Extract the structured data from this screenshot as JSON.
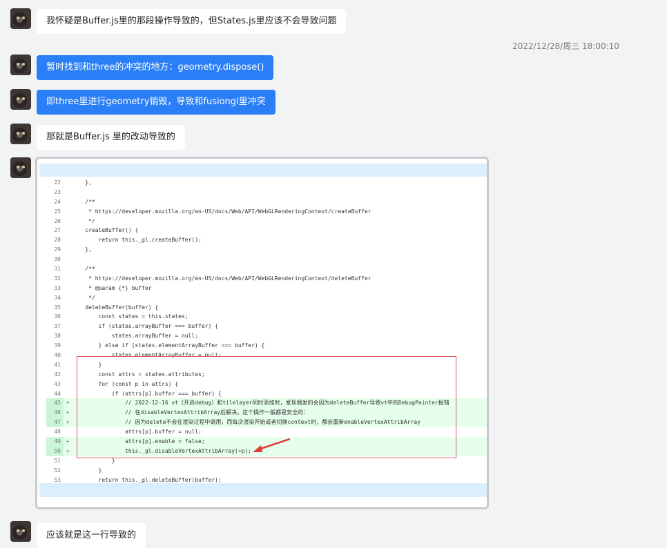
{
  "messages": [
    {
      "text": "我怀疑是Buffer.js里的那段操作导致的，但States.js里应该不会导致问题"
    },
    {
      "text": "暂时找到和three的冲突的地方：geometry.dispose()"
    },
    {
      "text": "即three里进行geometry销毁，导致和fusiongl里冲突"
    },
    {
      "text": "那就是Buffer.js 里的改动导致的"
    },
    {
      "text": "应该就是这一行导致的"
    }
  ],
  "timestamp": "2022/12/28/周三 18:00:10",
  "code": {
    "lines": [
      {
        "n": "22",
        "m": "",
        "t": "    },"
      },
      {
        "n": "23",
        "m": "",
        "t": ""
      },
      {
        "n": "24",
        "m": "",
        "t": "    /**"
      },
      {
        "n": "25",
        "m": "",
        "t": "     * https://developer.mozilla.org/en-US/docs/Web/API/WebGLRenderingContext/createBuffer"
      },
      {
        "n": "26",
        "m": "",
        "t": "     */"
      },
      {
        "n": "27",
        "m": "",
        "t": "    createBuffer() {"
      },
      {
        "n": "28",
        "m": "",
        "t": "        return this._gl.createBuffer();"
      },
      {
        "n": "29",
        "m": "",
        "t": "    },"
      },
      {
        "n": "30",
        "m": "",
        "t": ""
      },
      {
        "n": "31",
        "m": "",
        "t": "    /**"
      },
      {
        "n": "32",
        "m": "",
        "t": "     * https://developer.mozilla.org/en-US/docs/Web/API/WebGLRenderingContext/deleteBuffer"
      },
      {
        "n": "33",
        "m": "",
        "t": "     * @param {*} buffer"
      },
      {
        "n": "34",
        "m": "",
        "t": "     */"
      },
      {
        "n": "35",
        "m": "",
        "t": "    deleteBuffer(buffer) {"
      },
      {
        "n": "36",
        "m": "",
        "t": "        const states = this.states;"
      },
      {
        "n": "37",
        "m": "",
        "t": "        if (states.arrayBuffer === buffer) {"
      },
      {
        "n": "38",
        "m": "",
        "t": "            states.arrayBuffer = null;"
      },
      {
        "n": "39",
        "m": "",
        "t": "        } else if (states.elementArrayBuffer === buffer) {"
      },
      {
        "n": "40",
        "m": "",
        "t": "            states.elementArrayBuffer = null;"
      },
      {
        "n": "41",
        "m": "",
        "t": "        }"
      },
      {
        "n": "42",
        "m": "",
        "t": "        const attrs = states.attributes;"
      },
      {
        "n": "43",
        "m": "",
        "t": "        for (const p in attrs) {"
      },
      {
        "n": "44",
        "m": "",
        "t": "            if (attrs[p].buffer === buffer) {"
      },
      {
        "n": "45",
        "m": "+",
        "t": "                // 2022-12-16 vt（开启debug）和tilelayer同时添加时，发现偶发的会因为deleteBuffer导致vt中的DebugPainter报错"
      },
      {
        "n": "46",
        "m": "+",
        "t": "                // 在disableVertexAttribArray后解决。这个操作一般都是安全的："
      },
      {
        "n": "47",
        "m": "+",
        "t": "                // 因为delete不会在渲染过程中调用，而每次渲染开始或者切换context时，都会重新enableVertexAttribArray"
      },
      {
        "n": "48",
        "m": "",
        "t": "                attrs[p].buffer = null;"
      },
      {
        "n": "49",
        "m": "+",
        "t": "                attrs[p].enable = false;"
      },
      {
        "n": "50",
        "m": "+",
        "t": "                this._gl.disableVertexAttribArray(+p);"
      },
      {
        "n": "51",
        "m": "",
        "t": "            }"
      },
      {
        "n": "52",
        "m": "",
        "t": "        }"
      },
      {
        "n": "53",
        "m": "",
        "t": "        return this._gl.deleteBuffer(buffer);"
      }
    ]
  }
}
